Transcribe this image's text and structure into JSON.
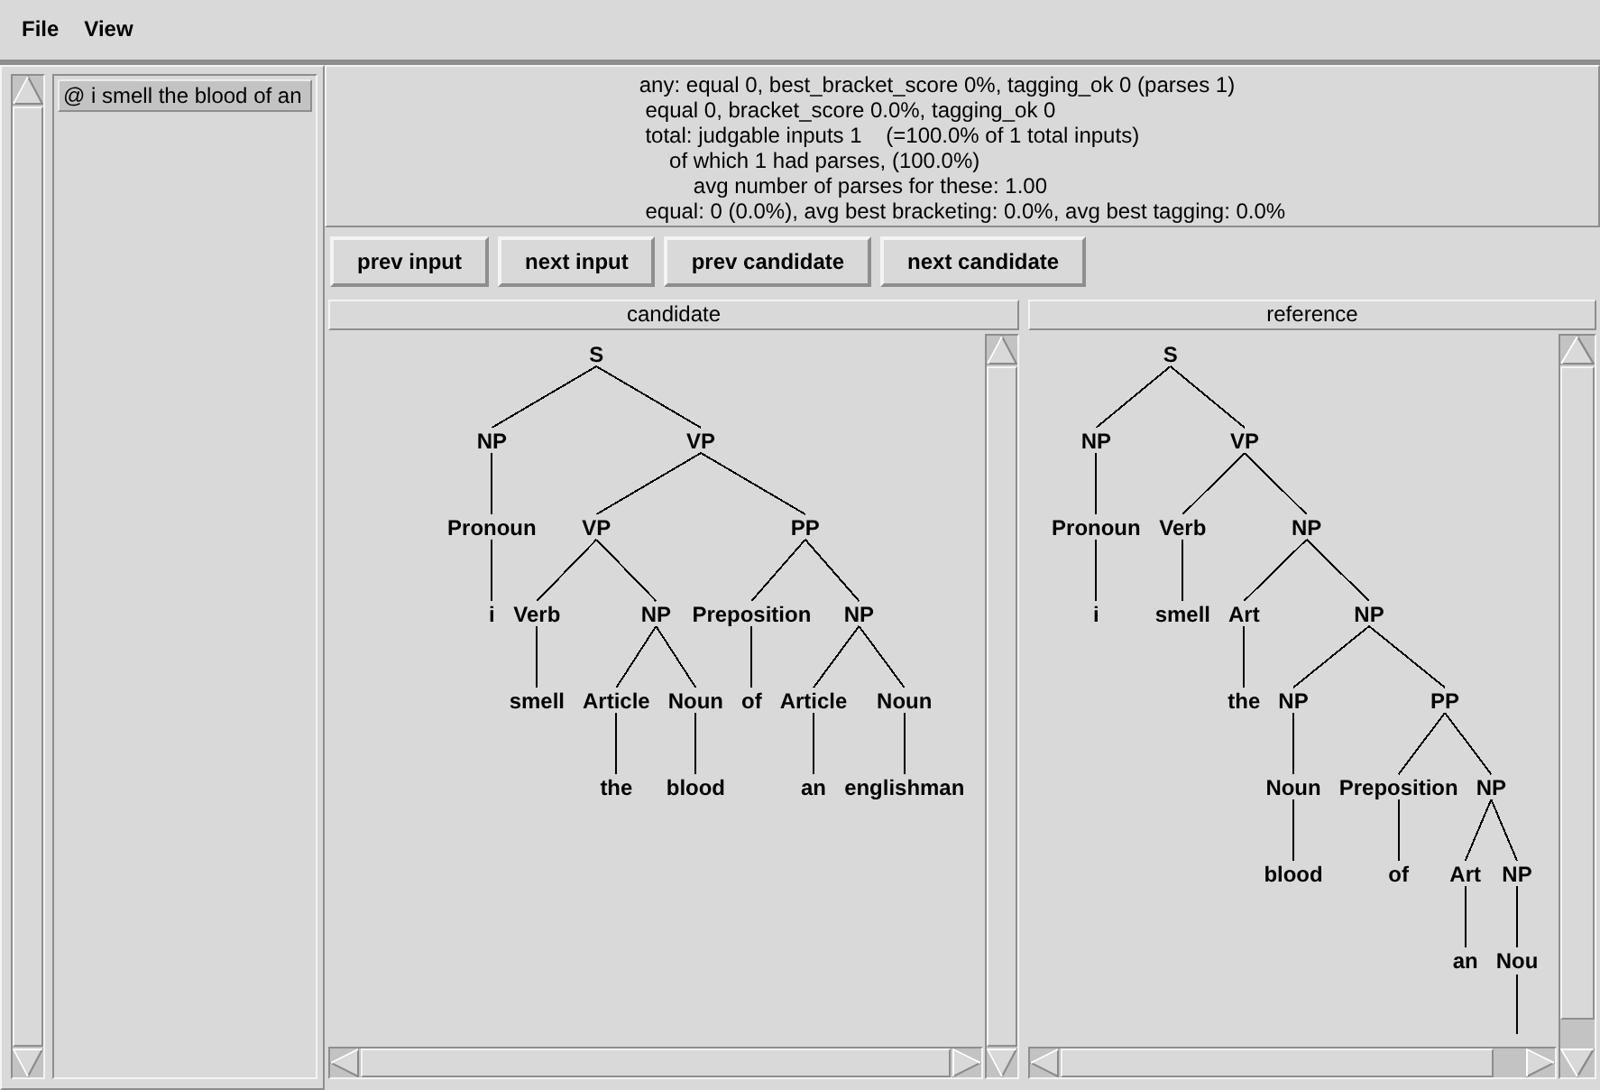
{
  "menu": [
    "File",
    "View"
  ],
  "input_list": [
    {
      "text": "@ i smell the blood of an",
      "selected": true
    }
  ],
  "statistics": [
    "any: equal 0, best_bracket_score 0%, tagging_ok 0 (parses 1)",
    " equal 0, bracket_score 0.0%, tagging_ok 0",
    " total: judgable inputs 1    (=100.0% of 1 total inputs)",
    "     of which 1 had parses, (100.0%)",
    "         avg number of parses for these: 1.00",
    " equal: 0 (0.0%), avg best bracketing: 0.0%, avg best tagging: 0.0%"
  ],
  "buttons": [
    "prev input",
    "next input",
    "prev candidate",
    "next candidate"
  ],
  "panes": [
    {
      "title": "candidate",
      "tree": {
        "label": "S",
        "children": [
          {
            "label": "NP",
            "children": [
              {
                "label": "Pronoun",
                "children": [
                  {
                    "label": "i"
                  }
                ]
              }
            ]
          },
          {
            "label": "VP",
            "children": [
              {
                "label": "VP",
                "children": [
                  {
                    "label": "Verb",
                    "children": [
                      {
                        "label": "smell"
                      }
                    ]
                  },
                  {
                    "label": "NP",
                    "children": [
                      {
                        "label": "Article",
                        "children": [
                          {
                            "label": "the"
                          }
                        ]
                      },
                      {
                        "label": "Noun",
                        "children": [
                          {
                            "label": "blood"
                          }
                        ]
                      }
                    ]
                  }
                ]
              },
              {
                "label": "PP",
                "children": [
                  {
                    "label": "Preposition",
                    "children": [
                      {
                        "label": "of"
                      }
                    ]
                  },
                  {
                    "label": "NP",
                    "children": [
                      {
                        "label": "Article",
                        "children": [
                          {
                            "label": "an"
                          }
                        ]
                      },
                      {
                        "label": "Noun",
                        "children": [
                          {
                            "label": "englishman"
                          }
                        ]
                      }
                    ]
                  }
                ]
              }
            ]
          }
        ]
      }
    },
    {
      "title": "reference",
      "tree": {
        "label": "S",
        "children": [
          {
            "label": "NP",
            "children": [
              {
                "label": "Pronoun",
                "children": [
                  {
                    "label": "i"
                  }
                ]
              }
            ]
          },
          {
            "label": "VP",
            "children": [
              {
                "label": "Verb",
                "children": [
                  {
                    "label": "smell"
                  }
                ]
              },
              {
                "label": "NP",
                "children": [
                  {
                    "label": "Art",
                    "children": [
                      {
                        "label": "the"
                      }
                    ]
                  },
                  {
                    "label": "NP",
                    "children": [
                      {
                        "label": "NP",
                        "children": [
                          {
                            "label": "Noun",
                            "children": [
                              {
                                "label": "blood"
                              }
                            ]
                          }
                        ]
                      },
                      {
                        "label": "PP",
                        "children": [
                          {
                            "label": "Preposition",
                            "children": [
                              {
                                "label": "of"
                              }
                            ]
                          },
                          {
                            "label": "NP",
                            "children": [
                              {
                                "label": "Art",
                                "children": [
                                  {
                                    "label": "an"
                                  }
                                ]
                              },
                              {
                                "label": "NP",
                                "children": [
                                  {
                                    "label": "Nou",
                                    "continues": true
                                  }
                                ]
                              }
                            ]
                          }
                        ]
                      }
                    ]
                  }
                ]
              }
            ]
          }
        ]
      }
    }
  ]
}
